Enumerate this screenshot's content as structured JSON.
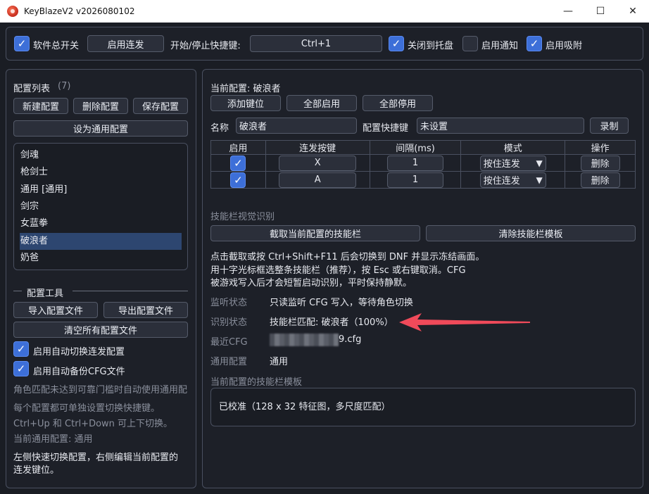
{
  "window": {
    "title": "KeyBlazeV2 v2026080102",
    "minimize": "—",
    "maximize": "☐",
    "close": "✕"
  },
  "topbar": {
    "master_switch": "软件总开关",
    "master_switch_checked": true,
    "enable_turbo_button": "启用连发",
    "hotkey_label": "开始/停止快捷键:",
    "hotkey_value": "Ctrl+1",
    "close_to_tray": "关闭到托盘",
    "close_to_tray_checked": true,
    "enable_notify": "启用通知",
    "enable_notify_checked": false,
    "enable_snap": "启用吸附",
    "enable_snap_checked": true
  },
  "left": {
    "config_list_title": "配置列表",
    "config_count": "(7)",
    "new_config": "新建配置",
    "delete_config": "删除配置",
    "save_config": "保存配置",
    "set_common": "设为通用配置",
    "configs": [
      "剑魂",
      "枪剑士",
      "通用 [通用]",
      "剑宗",
      "女蓝拳",
      "破浪者",
      "奶爸"
    ],
    "selected_index": 5,
    "tools_title": "配置工具",
    "import_config": "导入配置文件",
    "export_config": "导出配置文件",
    "clear_all": "清空所有配置文件",
    "auto_switch": "启用自动切换连发配置",
    "auto_backup": "启用自动备份CFG文件",
    "hint1": "角色匹配未达到可靠门槛时自动使用通用配",
    "hint2": "每个配置都可单独设置切换快捷键。",
    "hint3": "Ctrl+Up 和 Ctrl+Down 可上下切换。",
    "hint4": "当前通用配置: 通用",
    "hint5a": "左侧快速切换配置，右侧编辑当前配置的",
    "hint5b": "连发键位。"
  },
  "right": {
    "current_config_label": "当前配置: 破浪者",
    "add_key": "添加键位",
    "enable_all": "全部启用",
    "disable_all": "全部停用",
    "name_label": "名称",
    "name_value": "破浪者",
    "hotkey_label": "配置快捷键",
    "hotkey_value": "未设置",
    "record": "录制",
    "table_headers": [
      "启用",
      "连发按键",
      "间隔(ms)",
      "模式",
      "操作"
    ],
    "rows": [
      {
        "key": "X",
        "interval": "1",
        "mode": "按住连发",
        "action": "删除"
      },
      {
        "key": "A",
        "interval": "1",
        "mode": "按住连发",
        "action": "删除"
      }
    ],
    "vision_title": "技能栏视觉识别",
    "capture_btn": "截取当前配置的技能栏",
    "clear_template_btn": "清除技能栏模板",
    "desc1": "点击截取或按 Ctrl+Shift+F11 后会切换到 DNF 并显示冻结画面。",
    "desc2": "用十字光标框选整条技能栏（推荐），按 Esc 或右键取消。CFG",
    "desc3": "被游戏写入后才会短暂启动识别，平时保持静默。",
    "listen_label": "监听状态",
    "listen_value": "只读监听 CFG 写入，等待角色切换",
    "recog_label": "识别状态",
    "recog_value": "技能栏匹配: 破浪者（100%）",
    "recent_cfg_label": "最近CFG",
    "recent_cfg_value": "9.cfg",
    "common_label": "通用配置",
    "common_value": "通用",
    "template_title": "当前配置的技能栏模板",
    "template_value": "已校准（128 x 32 特征图，多尺度匹配）"
  },
  "colors": {
    "accent": "#3d6fd8",
    "arrow": "#f04a5a",
    "selection": "#2d4670"
  }
}
